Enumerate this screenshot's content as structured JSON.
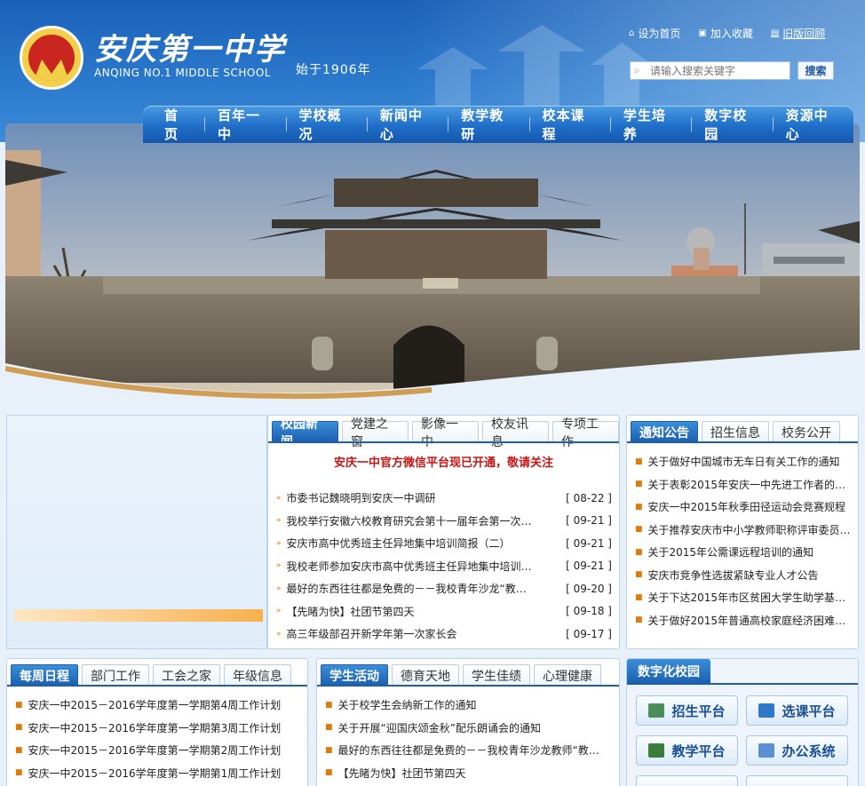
{
  "header": {
    "school_name_cn": "安庆第一中学",
    "school_name_en": "ANQING NO.1 MIDDLE SCHOOL",
    "since": "始于1906年",
    "top_links": [
      {
        "label": "设为首页",
        "icon": "home-icon"
      },
      {
        "label": "加入收藏",
        "icon": "bookmark-icon"
      },
      {
        "label": "旧版回顾",
        "icon": "archive-icon"
      }
    ],
    "search": {
      "placeholder": "请输入搜索关键字",
      "button": "搜索"
    }
  },
  "nav": [
    "首页",
    "百年一中",
    "学校概况",
    "新闻中心",
    "教学教研",
    "校本课程",
    "学生培养",
    "数字校园",
    "资源中心"
  ],
  "news": {
    "tabs": [
      "校园新闻",
      "党建之窗",
      "影像一中",
      "校友讯息",
      "专项工作"
    ],
    "headline": "安庆一中官方微信平台现已开通，敬请关注",
    "items": [
      {
        "title": "市委书记魏晓明到安庆一中调研",
        "date": "[ 08-22 ]"
      },
      {
        "title": "我校举行安徽六校教育研究会第十一届年会第一次…",
        "date": "[ 09-21 ]"
      },
      {
        "title": "安庆市高中优秀班主任异地集中培训简报（二）",
        "date": "[ 09-21 ]"
      },
      {
        "title": "我校老师参加安庆市高中优秀班主任异地集中培训…",
        "date": "[ 09-21 ]"
      },
      {
        "title": "最好的东西往往都是免费的－－我校青年沙龙“教…",
        "date": "[ 09-20 ]"
      },
      {
        "title": "【先睹为快】社团节第四天",
        "date": "[ 09-18 ]"
      },
      {
        "title": "高三年级部召开新学年第一次家长会",
        "date": "[ 09-17 ]"
      }
    ]
  },
  "notice": {
    "tabs": [
      "通知公告",
      "招生信息",
      "校务公开"
    ],
    "items": [
      "关于做好中国城市无车日有关工作的通知",
      "关于表彰2015年安庆一中先进工作者的决…",
      "安庆一中2015年秋季田径运动会竞赛规程",
      "关于推荐安庆市中小学教师职称评审委员…",
      "关于2015年公需课远程培训的通知",
      "安庆市竞争性选拔紧缺专业人才公告",
      "关于下达2015年市区贫困大学生助学基金…",
      "关于做好2015年普通高校家庭经济困难新…"
    ]
  },
  "schedule": {
    "tabs": [
      "每周日程",
      "部门工作",
      "工会之家",
      "年级信息"
    ],
    "items": [
      "安庆一中2015－2016学年度第一学期第4周工作计划",
      "安庆一中2015－2016学年度第一学期第3周工作计划",
      "安庆一中2015－2016学年度第一学期第2周工作计划",
      "安庆一中2015－2016学年度第一学期第1周工作计划"
    ]
  },
  "student": {
    "tabs": [
      "学生活动",
      "德育天地",
      "学生佳绩",
      "心理健康"
    ],
    "items": [
      "关于校学生会纳新工作的通知",
      "关于开展“迎国庆颂金秋”配乐朗诵会的通知",
      "最好的东西往往都是免费的－－我校青年沙龙教师“教…",
      "【先睹为快】社团节第四天"
    ]
  },
  "digital": {
    "title": "数字化校园",
    "buttons": [
      {
        "label": "招生平台",
        "icon": "enrollment-icon",
        "color": "#4a8e5a"
      },
      {
        "label": "选课平台",
        "icon": "course-icon",
        "color": "#2f78c8"
      },
      {
        "label": "教学平台",
        "icon": "teaching-icon",
        "color": "#3a7d3a"
      },
      {
        "label": "办公系统",
        "icon": "office-icon",
        "color": "#5a8fd0"
      }
    ]
  },
  "colors": {
    "primary": "#1b5fae",
    "accent": "#c81414",
    "bullet": "#e07a0a"
  }
}
